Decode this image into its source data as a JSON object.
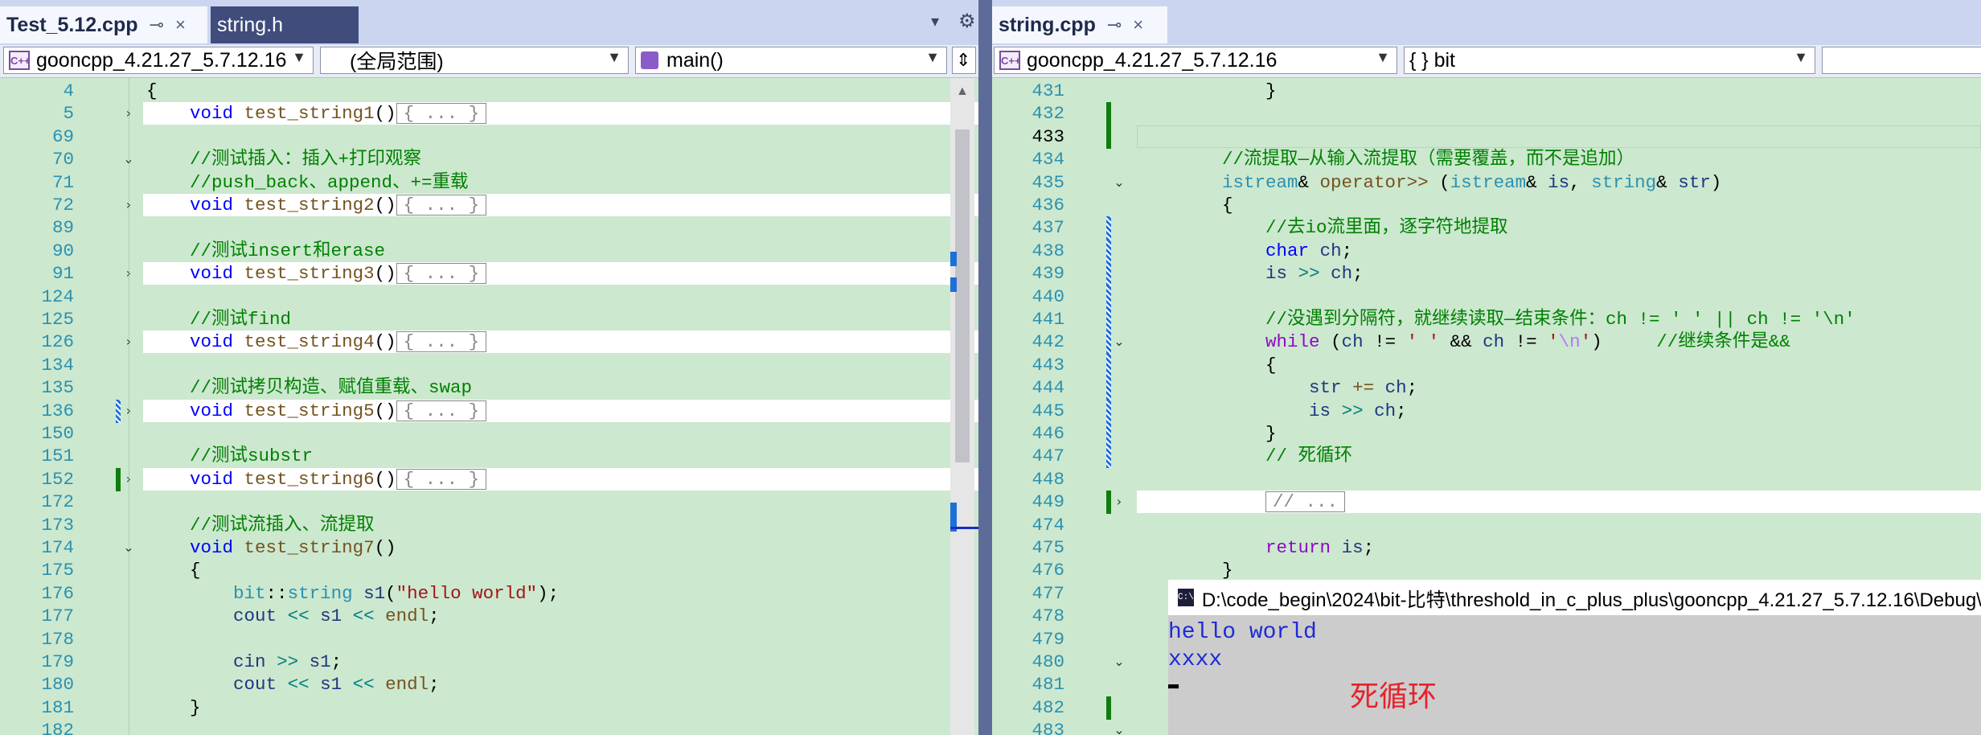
{
  "left": {
    "tabs": [
      {
        "label": "Test_5.12.cpp",
        "active": true,
        "pin": "⊸",
        "close": "×"
      },
      {
        "label": "string.h",
        "active": false
      }
    ],
    "overflow_icon": "▾",
    "settings_icon": "⚙",
    "nav": {
      "project": "gooncpp_4.21.27_5.7.12.16",
      "scope": "(全局范围)",
      "member": "main()"
    },
    "lines": [
      {
        "n": "4",
        "html": "{"
      },
      {
        "n": "5",
        "fold": "›",
        "highlight": true,
        "html": "    <span class='kw'>void</span> <span class='fn'>test_string1</span>()<span class='collapsed'>{ ... }</span>"
      },
      {
        "n": "69",
        "html": ""
      },
      {
        "n": "70",
        "fold": "⌄",
        "html": "    <span class='cm'>//测试插入：插入+打印观察</span>"
      },
      {
        "n": "71",
        "html": "    <span class='cm'>//push_back、append、+=重载</span>"
      },
      {
        "n": "72",
        "fold": "›",
        "highlight": true,
        "html": "    <span class='kw'>void</span> <span class='fn'>test_string2</span>()<span class='collapsed'>{ ... }</span>"
      },
      {
        "n": "89",
        "html": ""
      },
      {
        "n": "90",
        "html": "    <span class='cm'>//测试insert和erase</span>"
      },
      {
        "n": "91",
        "fold": "›",
        "highlight": true,
        "html": "    <span class='kw'>void</span> <span class='fn'>test_string3</span>()<span class='collapsed'>{ ... }</span>"
      },
      {
        "n": "124",
        "html": ""
      },
      {
        "n": "125",
        "html": "    <span class='cm'>//测试find</span>"
      },
      {
        "n": "126",
        "fold": "›",
        "highlight": true,
        "html": "    <span class='kw'>void</span> <span class='fn'>test_string4</span>()<span class='collapsed'>{ ... }</span>"
      },
      {
        "n": "134",
        "html": ""
      },
      {
        "n": "135",
        "html": "    <span class='cm'>//测试拷贝构造、赋值重载、swap</span>"
      },
      {
        "n": "136",
        "fold": "›",
        "highlight": true,
        "marker": "blue",
        "html": "    <span class='kw'>void</span> <span class='fn'>test_string5</span>()<span class='collapsed'>{ ... }</span>"
      },
      {
        "n": "150",
        "html": ""
      },
      {
        "n": "151",
        "html": "    <span class='cm'>//测试substr</span>"
      },
      {
        "n": "152",
        "fold": "›",
        "highlight": true,
        "marker": "green",
        "html": "    <span class='kw'>void</span> <span class='fn'>test_string6</span>()<span class='collapsed'>{ ... }</span>"
      },
      {
        "n": "172",
        "html": ""
      },
      {
        "n": "173",
        "html": "    <span class='cm'>//测试流插入、流提取</span>"
      },
      {
        "n": "174",
        "fold": "⌄",
        "html": "    <span class='kw'>void</span> <span class='fn'>test_string7</span>()"
      },
      {
        "n": "175",
        "html": "    {"
      },
      {
        "n": "176",
        "html": "        <span class='ty'>bit</span>::<span class='ty'>string</span> <span class='va'>s1</span>(<span class='st'>\"hello world\"</span>);"
      },
      {
        "n": "177",
        "html": "        <span class='va'>cout</span> <span class='op'>&lt;&lt;</span> <span class='va'>s1</span> <span class='op'>&lt;&lt;</span> <span class='fn'>endl</span>;"
      },
      {
        "n": "178",
        "html": ""
      },
      {
        "n": "179",
        "html": "        <span class='va'>cin</span> <span class='op'>&gt;&gt;</span> <span class='va'>s1</span>;"
      },
      {
        "n": "180",
        "html": "        <span class='va'>cout</span> <span class='op'>&lt;&lt;</span> <span class='va'>s1</span> <span class='op'>&lt;&lt;</span> <span class='fn'>endl</span>;"
      },
      {
        "n": "181",
        "html": "    }"
      },
      {
        "n": "182",
        "html": ""
      }
    ]
  },
  "right": {
    "tabs": [
      {
        "label": "string.cpp",
        "active": true,
        "pin": "⊸",
        "close": "×"
      }
    ],
    "nav": {
      "project": "gooncpp_4.21.27_5.7.12.16",
      "scope": "{ } bit"
    },
    "lines": [
      {
        "n": "431",
        "html": "        }"
      },
      {
        "n": "432",
        "marker": "green",
        "html": ""
      },
      {
        "n": "433",
        "current": true,
        "marker": "green",
        "html": ""
      },
      {
        "n": "434",
        "html": "    <span class='cm'>//流提取—从输入流提取（需要覆盖，而不是追加）</span>"
      },
      {
        "n": "435",
        "fold": "⌄",
        "html": "    <span class='ty'>istream</span>&amp; <span class='fn'>operator&gt;&gt;</span> (<span class='ty'>istream</span>&amp; <span class='va'>is</span>, <span class='ty'>string</span>&amp; <span class='va'>str</span>)"
      },
      {
        "n": "436",
        "html": "    {"
      },
      {
        "n": "437",
        "marker": "blue",
        "html": "        <span class='cm'>//去io流里面，逐字符地提取</span>"
      },
      {
        "n": "438",
        "marker": "blue",
        "html": "        <span class='kw'>char</span> <span class='va'>ch</span>;"
      },
      {
        "n": "439",
        "marker": "blue",
        "html": "        <span class='va'>is</span> <span class='op'>&gt;&gt;</span> <span class='va'>ch</span>;"
      },
      {
        "n": "440",
        "marker": "blue",
        "html": ""
      },
      {
        "n": "441",
        "marker": "blue",
        "html": "        <span class='cm'>//没遇到分隔符，就继续读取—结束条件：ch != ' ' || ch != '\\n'</span>"
      },
      {
        "n": "442",
        "fold": "⌄",
        "marker": "blue",
        "html": "        <span class='ctl'>while</span> (<span class='va'>ch</span> != <span class='st'>' '</span> &amp;&amp; <span class='va'>ch</span> != <span class='st'>'</span><span class='es'>\\n</span><span class='st'>'</span>)     <span class='cm'>//继续条件是&amp;&amp;</span>"
      },
      {
        "n": "443",
        "marker": "blue",
        "html": "        {"
      },
      {
        "n": "444",
        "marker": "blue",
        "html": "            <span class='va'>str</span> <span class='fn'>+=</span> <span class='va'>ch</span>;"
      },
      {
        "n": "445",
        "marker": "blue",
        "html": "            <span class='va'>is</span> <span class='op'>&gt;&gt;</span> <span class='va'>ch</span>;"
      },
      {
        "n": "446",
        "marker": "blue",
        "html": "        }"
      },
      {
        "n": "447",
        "marker": "blue",
        "html": "        <span class='cm'>// 死循环</span>"
      },
      {
        "n": "448",
        "html": ""
      },
      {
        "n": "449",
        "fold": "›",
        "highlight": true,
        "marker": "green",
        "html": "        <span class='collapsed'>// ...</span>"
      },
      {
        "n": "474",
        "html": ""
      },
      {
        "n": "475",
        "html": "        <span class='ctl'>return</span> <span class='va'>is</span>;"
      },
      {
        "n": "476",
        "html": "    }"
      },
      {
        "n": "477",
        "html": ""
      },
      {
        "n": "478",
        "html": ""
      },
      {
        "n": "479",
        "html": ""
      },
      {
        "n": "480",
        "fold": "⌄",
        "html": ""
      },
      {
        "n": "481",
        "html": ""
      },
      {
        "n": "482",
        "marker": "green",
        "html": ""
      },
      {
        "n": "483",
        "fold": "⌄",
        "html": ""
      }
    ]
  },
  "console": {
    "title": "D:\\code_begin\\2024\\bit-比特\\threshold_in_c_plus_plus\\gooncpp_4.21.27_5.7.12.16\\Debug\\",
    "icon_text": "C:\\",
    "output": [
      "hello world",
      "xxxx"
    ],
    "cursor": "▬",
    "annotation": "死循环",
    "annotation_color": "#e8202a"
  },
  "colors": {
    "editor_bg": "#cce8cf",
    "frame": "#5d6b99",
    "tab_active": "#f5f7ff"
  }
}
